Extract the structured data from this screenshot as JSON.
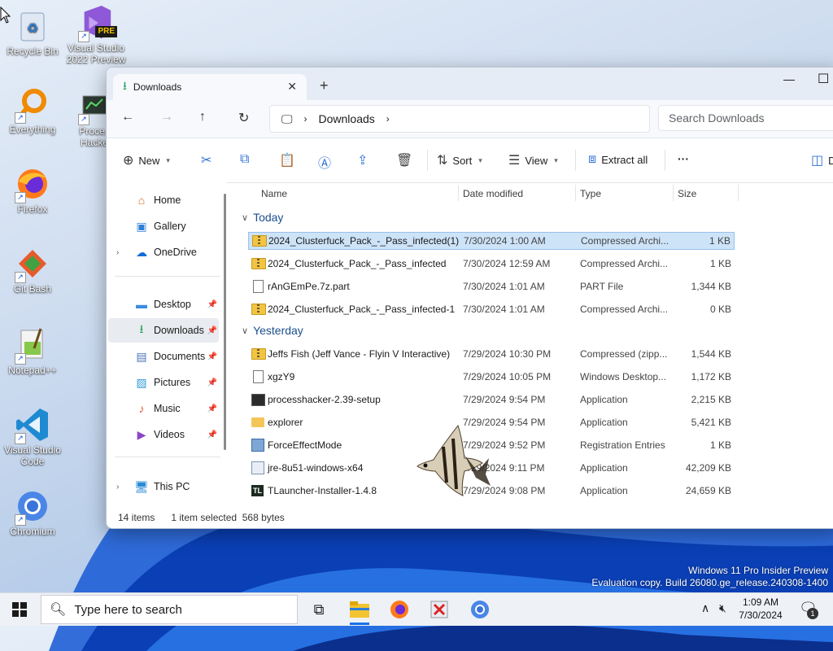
{
  "desktop": {
    "icons": [
      {
        "label": "Recycle Bin"
      },
      {
        "label": "Visual Studio 2022 Preview",
        "badge": "PRE"
      },
      {
        "label": "Everything"
      },
      {
        "label": "Proce... Hacker"
      },
      {
        "label": "Firefox"
      },
      {
        "label": "Git Bash"
      },
      {
        "label": "Notepad++"
      },
      {
        "label": "Visual Studio Code"
      },
      {
        "label": "Chromium"
      }
    ],
    "watermark": {
      "line1": "Windows 11 Pro Insider Preview",
      "line2": "Evaluation copy. Build 26080.ge_release.240308-1400"
    }
  },
  "explorer": {
    "tab_title": "Downloads",
    "address": {
      "segment": "Downloads"
    },
    "search_placeholder": "Search Downloads",
    "toolbar": {
      "new": "New",
      "sort": "Sort",
      "view": "View",
      "extract_all": "Extract all",
      "more": "···",
      "details_cut": "D"
    },
    "sidebar": {
      "items": [
        {
          "label": "Home",
          "icon": "home-icon"
        },
        {
          "label": "Gallery",
          "icon": "gallery-icon"
        },
        {
          "label": "OneDrive",
          "icon": "cloud-icon"
        },
        {
          "label": "Desktop",
          "icon": "desktop-icon"
        },
        {
          "label": "Downloads",
          "icon": "download-icon"
        },
        {
          "label": "Documents",
          "icon": "documents-icon"
        },
        {
          "label": "Pictures",
          "icon": "pictures-icon"
        },
        {
          "label": "Music",
          "icon": "music-icon"
        },
        {
          "label": "Videos",
          "icon": "videos-icon"
        },
        {
          "label": "This PC",
          "icon": "pc-icon"
        }
      ]
    },
    "columns": {
      "name": "Name",
      "date": "Date modified",
      "type": "Type",
      "size": "Size"
    },
    "groups": {
      "today": "Today",
      "yesterday": "Yesterday"
    },
    "files": [
      {
        "name": "2024_Clusterfuck_Pack_-_Pass_infected(1)",
        "date": "7/30/2024 1:00 AM",
        "type": "Compressed Archi...",
        "size": "1 KB"
      },
      {
        "name": "2024_Clusterfuck_Pack_-_Pass_infected",
        "date": "7/30/2024 12:59 AM",
        "type": "Compressed Archi...",
        "size": "1 KB"
      },
      {
        "name": "rAnGEmPe.7z.part",
        "date": "7/30/2024 1:01 AM",
        "type": "PART File",
        "size": "1,344 KB"
      },
      {
        "name": "2024_Clusterfuck_Pack_-_Pass_infected-1",
        "date": "7/30/2024 1:01 AM",
        "type": "Compressed Archi...",
        "size": "0 KB"
      },
      {
        "name": "Jeffs Fish (Jeff Vance - Flyin V Interactive)",
        "date": "7/29/2024 10:30 PM",
        "type": "Compressed (zipp...",
        "size": "1,544 KB"
      },
      {
        "name": "xgzY9",
        "date": "7/29/2024 10:05 PM",
        "type": "Windows Desktop...",
        "size": "1,172 KB"
      },
      {
        "name": "processhacker-2.39-setup",
        "date": "7/29/2024 9:54 PM",
        "type": "Application",
        "size": "2,215 KB"
      },
      {
        "name": "explorer",
        "date": "7/29/2024 9:54 PM",
        "type": "Application",
        "size": "5,421 KB"
      },
      {
        "name": "ForceEffectMode",
        "date": "7/29/2024 9:52 PM",
        "type": "Registration Entries",
        "size": "1 KB"
      },
      {
        "name": "jre-8u51-windows-x64",
        "date": "7/29/2024 9:11 PM",
        "type": "Application",
        "size": "42,209 KB"
      },
      {
        "name": "TLauncher-Installer-1.4.8",
        "date": "7/29/2024 9:08 PM",
        "type": "Application",
        "size": "24,659 KB"
      }
    ],
    "status": {
      "count": "14 items",
      "selected": "1 item selected",
      "bytes": "568 bytes"
    }
  },
  "taskbar": {
    "search_placeholder": "Type here to search",
    "time": "1:09 AM",
    "date": "7/30/2024",
    "notifications": "1"
  }
}
